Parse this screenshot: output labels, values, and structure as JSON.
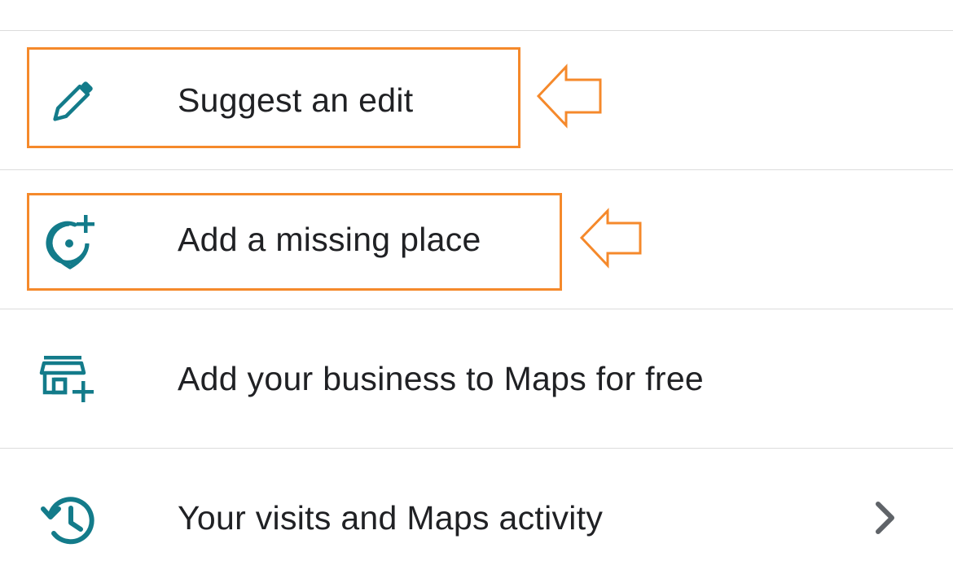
{
  "menu": {
    "items": [
      {
        "label": "Suggest an edit",
        "icon": "pencil-icon"
      },
      {
        "label": "Add a missing place",
        "icon": "add-place-pin-icon"
      },
      {
        "label": "Add your business to Maps for free",
        "icon": "storefront-add-icon"
      },
      {
        "label": "Your visits and Maps activity",
        "icon": "history-icon",
        "trailing_icon": "chevron-right-icon"
      }
    ]
  },
  "annotations": {
    "highlighted_items": [
      "Suggest an edit",
      "Add a missing place"
    ],
    "highlight_color": "#f5892b"
  },
  "colors": {
    "icon": "#137b8a",
    "text": "#202124",
    "divider": "#dcdcdc",
    "chevron": "#5f6368"
  }
}
